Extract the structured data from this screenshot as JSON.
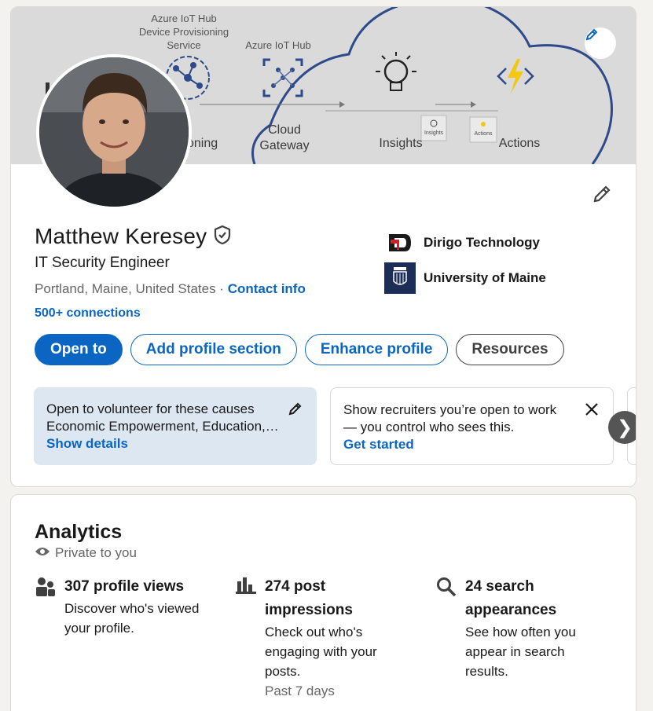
{
  "banner": {
    "labels": {
      "dps_line1": "Azure IoT Hub",
      "dps_line2": "Device Provisioning",
      "dps_line3": "Service",
      "hub": "Azure IoT Hub",
      "provisioning": "oning",
      "cloud_line1": "Cloud",
      "cloud_line2": "Gateway",
      "insights": "Insights",
      "actions": "Actions",
      "insights_small": "Insights",
      "actions_small": "Actions"
    }
  },
  "profile": {
    "name": "Matthew Keresey",
    "headline": "IT Security Engineer",
    "location": "Portland, Maine, United States",
    "separator": " · ",
    "contact_info": "Contact info",
    "connections": "500+ connections",
    "organizations": [
      {
        "name": "Dirigo Technology",
        "logo": "dirigo-logo"
      },
      {
        "name": "University of Maine",
        "logo": "umaine-logo"
      }
    ]
  },
  "actions": {
    "open_to": "Open to",
    "add_section": "Add profile section",
    "enhance": "Enhance profile",
    "resources": "Resources"
  },
  "open_cards": [
    {
      "title": "Open to volunteer for these causes",
      "desc": "Economic Empowerment, Education,…",
      "action": "Show details",
      "icon": "pencil-icon"
    },
    {
      "title": "Show recruiters you’re open to work",
      "desc": " — you control who sees this.",
      "action": "Get started",
      "icon": "close-icon"
    }
  ],
  "carousel": {
    "next": "❯"
  },
  "analytics": {
    "title": "Analytics",
    "privacy": "Private to you",
    "metrics": [
      {
        "title": "307 profile views",
        "desc": "Discover who's viewed your profile.",
        "icon": "people-icon"
      },
      {
        "title": "274 post impressions",
        "desc": "Check out who's engaging with your posts.",
        "footnote": "Past 7 days",
        "icon": "bar-chart-icon"
      },
      {
        "title": "24 search appearances",
        "desc": "See how often you appear in search results.",
        "icon": "search-icon"
      }
    ]
  },
  "colors": {
    "brand_blue": "#0a66c2",
    "banner_bg": "#dadada",
    "card_bg": "#ffffff",
    "page_bg": "#f4f2ee",
    "cause_card_bg": "#dde7f1"
  }
}
